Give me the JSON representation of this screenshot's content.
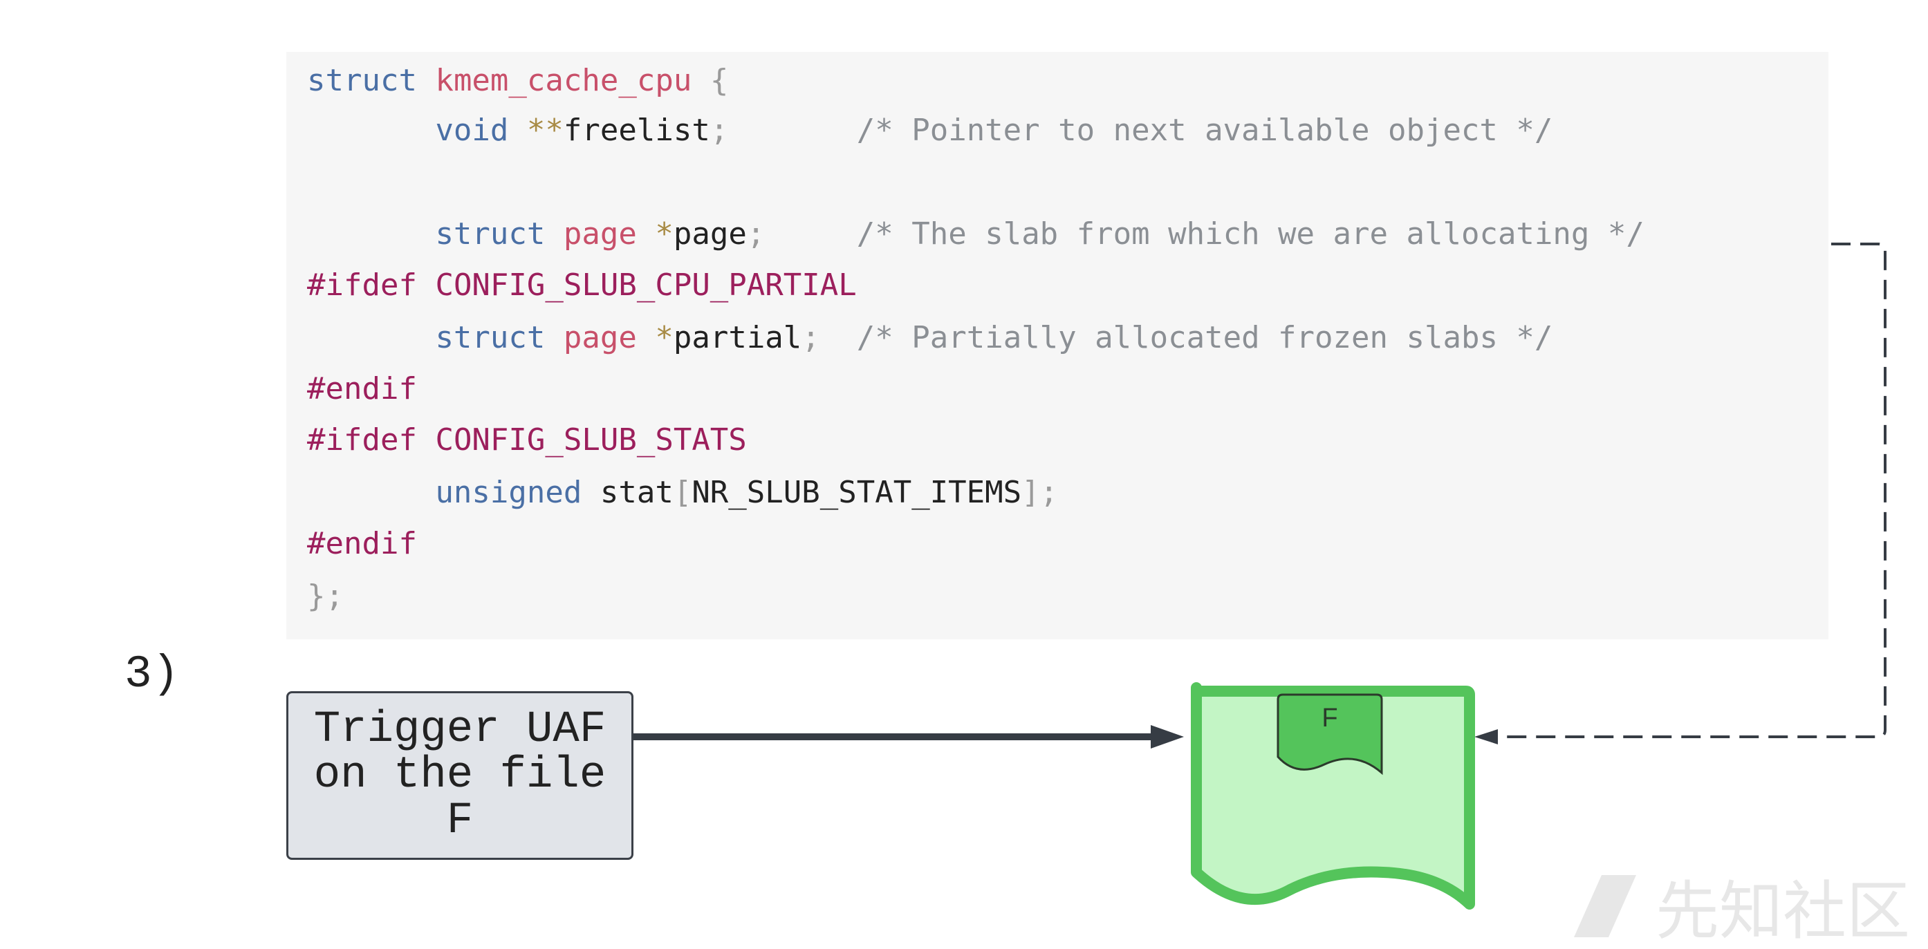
{
  "code": {
    "lines": [
      [
        {
          "t": "kw",
          "v": "struct"
        },
        {
          "t": "id",
          "v": " "
        },
        {
          "t": "ty",
          "v": "kmem_cache_cpu"
        },
        {
          "t": "id",
          "v": " "
        },
        {
          "t": "pu",
          "v": "{"
        }
      ],
      [
        {
          "t": "id",
          "v": "       "
        },
        {
          "t": "kw",
          "v": "void"
        },
        {
          "t": "id",
          "v": " "
        },
        {
          "t": "op",
          "v": "**"
        },
        {
          "t": "id",
          "v": "freelist"
        },
        {
          "t": "pu",
          "v": ";"
        },
        {
          "t": "id",
          "v": "       "
        },
        {
          "t": "cm",
          "v": "/* Pointer to next available object */"
        }
      ],
      [],
      [
        {
          "t": "id",
          "v": "       "
        },
        {
          "t": "kw",
          "v": "struct"
        },
        {
          "t": "id",
          "v": " "
        },
        {
          "t": "ty",
          "v": "page"
        },
        {
          "t": "id",
          "v": " "
        },
        {
          "t": "op",
          "v": "*"
        },
        {
          "t": "id",
          "v": "page"
        },
        {
          "t": "pu",
          "v": ";"
        },
        {
          "t": "id",
          "v": "     "
        },
        {
          "t": "cm",
          "v": "/* The slab from which we are allocating */"
        }
      ],
      [
        {
          "t": "pp",
          "v": "#ifdef"
        },
        {
          "t": "id",
          "v": " "
        },
        {
          "t": "pp",
          "v": "CONFIG_SLUB_CPU_PARTIAL"
        }
      ],
      [
        {
          "t": "id",
          "v": "       "
        },
        {
          "t": "kw",
          "v": "struct"
        },
        {
          "t": "id",
          "v": " "
        },
        {
          "t": "ty",
          "v": "page"
        },
        {
          "t": "id",
          "v": " "
        },
        {
          "t": "op",
          "v": "*"
        },
        {
          "t": "id",
          "v": "partial"
        },
        {
          "t": "pu",
          "v": ";"
        },
        {
          "t": "id",
          "v": "  "
        },
        {
          "t": "cm",
          "v": "/* Partially allocated frozen slabs */"
        }
      ],
      [
        {
          "t": "pp",
          "v": "#endif"
        }
      ],
      [
        {
          "t": "pp",
          "v": "#ifdef"
        },
        {
          "t": "id",
          "v": " "
        },
        {
          "t": "pp",
          "v": "CONFIG_SLUB_STATS"
        }
      ],
      [
        {
          "t": "id",
          "v": "       "
        },
        {
          "t": "kw",
          "v": "unsigned"
        },
        {
          "t": "id",
          "v": " stat"
        },
        {
          "t": "pu",
          "v": "["
        },
        {
          "t": "id",
          "v": "NR_SLUB_STAT_ITEMS"
        },
        {
          "t": "pu",
          "v": "];"
        }
      ],
      [
        {
          "t": "pp",
          "v": "#endif"
        }
      ],
      [
        {
          "t": "pu",
          "v": "};"
        }
      ]
    ]
  },
  "step_label": "3)",
  "trigger_box": {
    "text": "Trigger UAF\non the file\nF"
  },
  "slab_page": {
    "file_label": "F"
  },
  "colors": {
    "code_bg": "#f6f6f6",
    "keyword": "#4a6fa5",
    "type": "#c8506a",
    "preprocessor": "#9c1f5c",
    "comment": "#8b8f94",
    "trigger_fill": "#e1e4e9",
    "slab_fill": "#c3f5c5",
    "slab_border": "#54c45b",
    "file_fill": "#54c45b",
    "arrow": "#363c44"
  },
  "icons": {
    "watermark": "xianzhi-logo"
  }
}
